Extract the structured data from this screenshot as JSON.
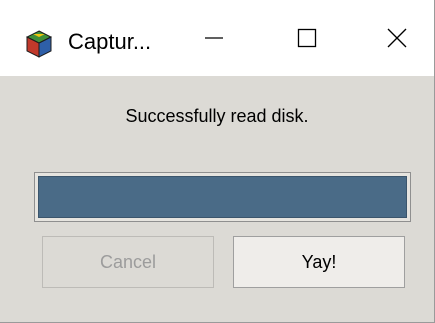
{
  "window": {
    "title": "Captur..."
  },
  "dialog": {
    "message": "Successfully read disk.",
    "progress_fraction": 1.0,
    "cancel_label": "Cancel",
    "cancel_enabled": false,
    "confirm_label": "Yay!"
  },
  "icons": {
    "app": "colored-cube-icon",
    "minimize": "minimize-icon",
    "maximize": "maximize-icon",
    "close": "close-icon"
  },
  "colors": {
    "progress_fill": "#4a6b87",
    "window_bg": "#dcdad5"
  }
}
